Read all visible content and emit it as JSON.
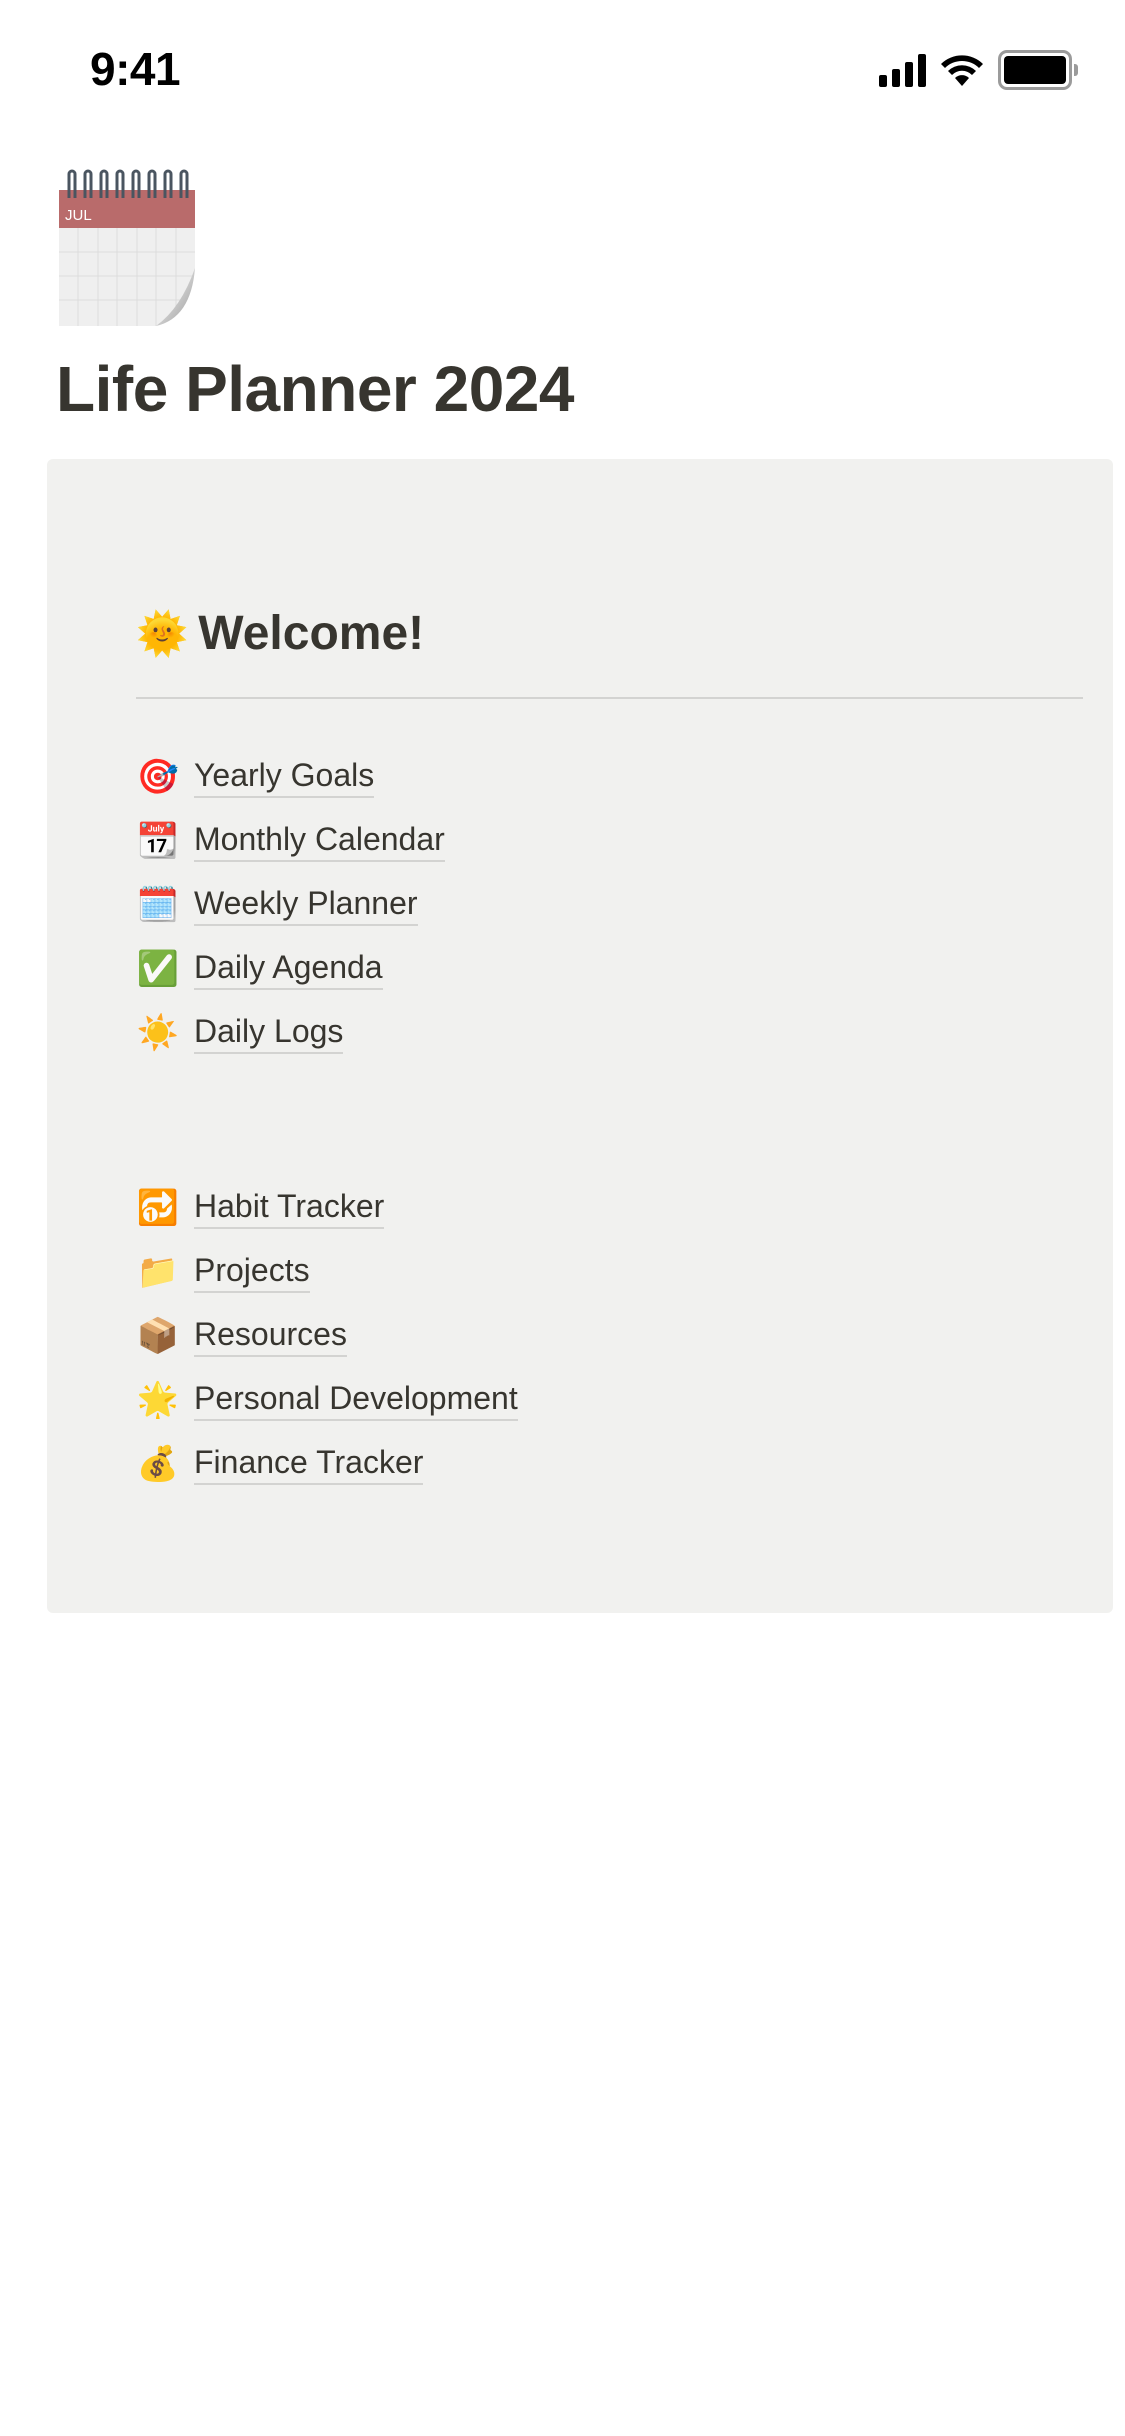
{
  "status_bar": {
    "time": "9:41",
    "icons": [
      "cellular-signal-icon",
      "wifi-icon",
      "battery-icon"
    ]
  },
  "page": {
    "icon": "spiral-calendar-icon",
    "icon_month_label": "JUL",
    "title": "Life Planner 2024"
  },
  "callout": {
    "heading_emoji": "🌞",
    "heading_icon": "sun-with-face-icon",
    "heading": "Welcome!",
    "groups": [
      {
        "links": [
          {
            "emoji": "🎯",
            "icon": "direct-hit-icon",
            "label": "Yearly Goals"
          },
          {
            "emoji": "📆",
            "icon": "tear-off-calendar-icon",
            "label": "Monthly Calendar"
          },
          {
            "emoji": "🗓️",
            "icon": "spiral-calendar-icon",
            "label": "Weekly Planner"
          },
          {
            "emoji": "✅",
            "icon": "check-mark-button-icon",
            "label": "Daily Agenda"
          },
          {
            "emoji": "☀️",
            "icon": "sun-icon",
            "label": "Daily Logs"
          }
        ]
      },
      {
        "links": [
          {
            "emoji": "🔂",
            "icon": "repeat-single-icon",
            "label": "Habit Tracker"
          },
          {
            "emoji": "📁",
            "icon": "file-folder-icon",
            "label": "Projects"
          },
          {
            "emoji": "📦",
            "icon": "package-icon",
            "label": "Resources"
          },
          {
            "emoji": "🌟",
            "icon": "glowing-star-icon",
            "label": "Personal Development"
          },
          {
            "emoji": "💰",
            "icon": "money-bag-icon",
            "label": "Finance Tracker"
          }
        ]
      }
    ]
  },
  "colors": {
    "text": "#37352f",
    "callout_bg": "#f1f1ef",
    "divider": "#d3d3d1",
    "calendar_header": "#b96b6b"
  }
}
